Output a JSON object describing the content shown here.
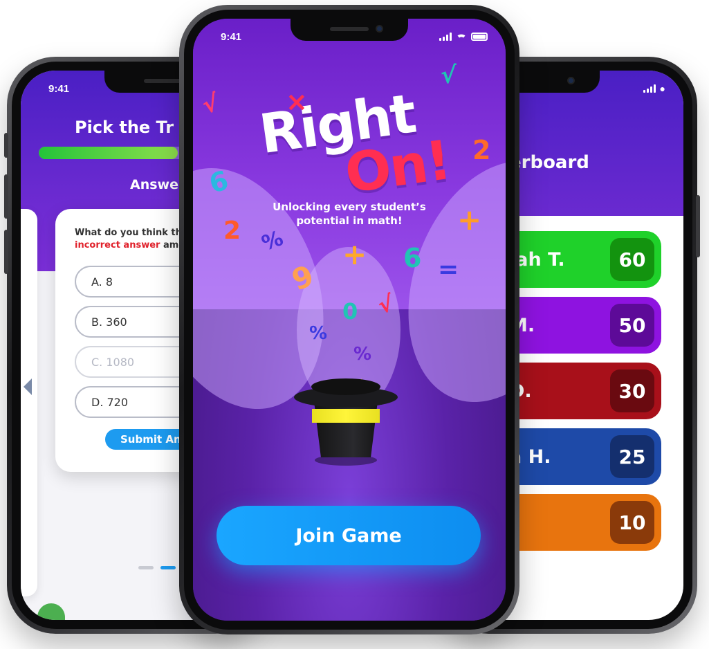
{
  "status": {
    "time": "9:41"
  },
  "quiz": {
    "title": "Pick the Tr",
    "progress": 0.67,
    "subtitle": "Answe",
    "question_prefix": "What do you think th",
    "question_highlight": "incorrect answer",
    "question_suffix": " amon",
    "options": [
      {
        "label": "A. 8",
        "disabled": false
      },
      {
        "label": "B. 360",
        "disabled": false
      },
      {
        "label": "C. 1080",
        "disabled": true
      },
      {
        "label": "D. 720",
        "disabled": false
      }
    ],
    "submit_label": "Submit Ans",
    "page_dots": 2,
    "active_dot": 1
  },
  "landing": {
    "logo_word1": "Right",
    "logo_word2": "On!",
    "tagline_line1": "Unlocking every student’s",
    "tagline_line2": "potential in math!",
    "join_label": "Join Game",
    "accent_color": "#1aa6ff"
  },
  "leaderboard": {
    "title": "erboard",
    "rows": [
      {
        "name": "iah T.",
        "score": "60",
        "color": "#1fd12a",
        "score_bg": "#13930f"
      },
      {
        "name": "M.",
        "score": "50",
        "color": "#8e13e0",
        "score_bg": "#5d0a98"
      },
      {
        "name": "D.",
        "score": "30",
        "color": "#a8101a",
        "score_bg": "#6a0a10"
      },
      {
        "name": "a H.",
        "score": "25",
        "color": "#1e4aa8",
        "score_bg": "#142f6e"
      },
      {
        "name": ".",
        "score": "10",
        "color": "#e8740e",
        "score_bg": "#8a3a0a"
      }
    ]
  }
}
